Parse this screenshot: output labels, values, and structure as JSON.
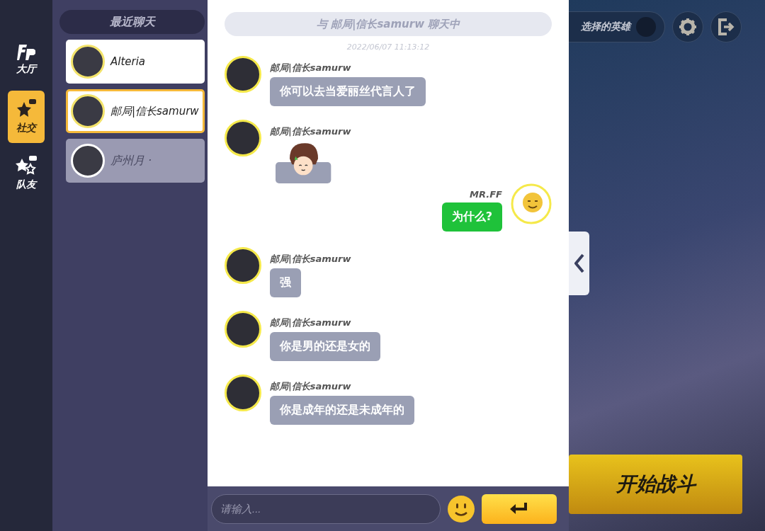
{
  "nav": [
    {
      "label": "大厅",
      "kind": "logo",
      "selected": false
    },
    {
      "label": "社交",
      "kind": "social",
      "selected": true
    },
    {
      "label": "队友",
      "kind": "team",
      "selected": false
    }
  ],
  "contacts": {
    "title": "最近聊天",
    "items": [
      {
        "name": "Alteria",
        "selected": false,
        "online": true,
        "color": "#f3e36a"
      },
      {
        "name": "邮局|信长samurw",
        "selected": true,
        "online": true,
        "color": "#f3e36a"
      },
      {
        "name": "庐州月 ·",
        "selected": false,
        "online": false,
        "color": "#ffffff"
      }
    ]
  },
  "chat": {
    "header": "与 邮局|信长samurw 聊天中",
    "timestamp": "2022/06/07 11:13:12",
    "messages": [
      {
        "sender": "邮局|信长samurw",
        "mine": false,
        "kind": "text",
        "text": "你可以去当爱丽丝代言人了"
      },
      {
        "sender": "邮局|信长samurw",
        "mine": false,
        "kind": "sticker"
      },
      {
        "sender": "MR.FF",
        "mine": true,
        "kind": "text",
        "text": "为什么?"
      },
      {
        "sender": "邮局|信长samurw",
        "mine": false,
        "kind": "text",
        "text": "强"
      },
      {
        "sender": "邮局|信长samurw",
        "mine": false,
        "kind": "text",
        "text": "你是男的还是女的"
      },
      {
        "sender": "邮局|信长samurw",
        "mine": false,
        "kind": "text",
        "text": "你是成年的还是未成年的"
      }
    ],
    "input": {
      "placeholder": "请输入..."
    }
  },
  "right": {
    "hero_label": "选择的英雄",
    "start_button": "开始战斗"
  }
}
